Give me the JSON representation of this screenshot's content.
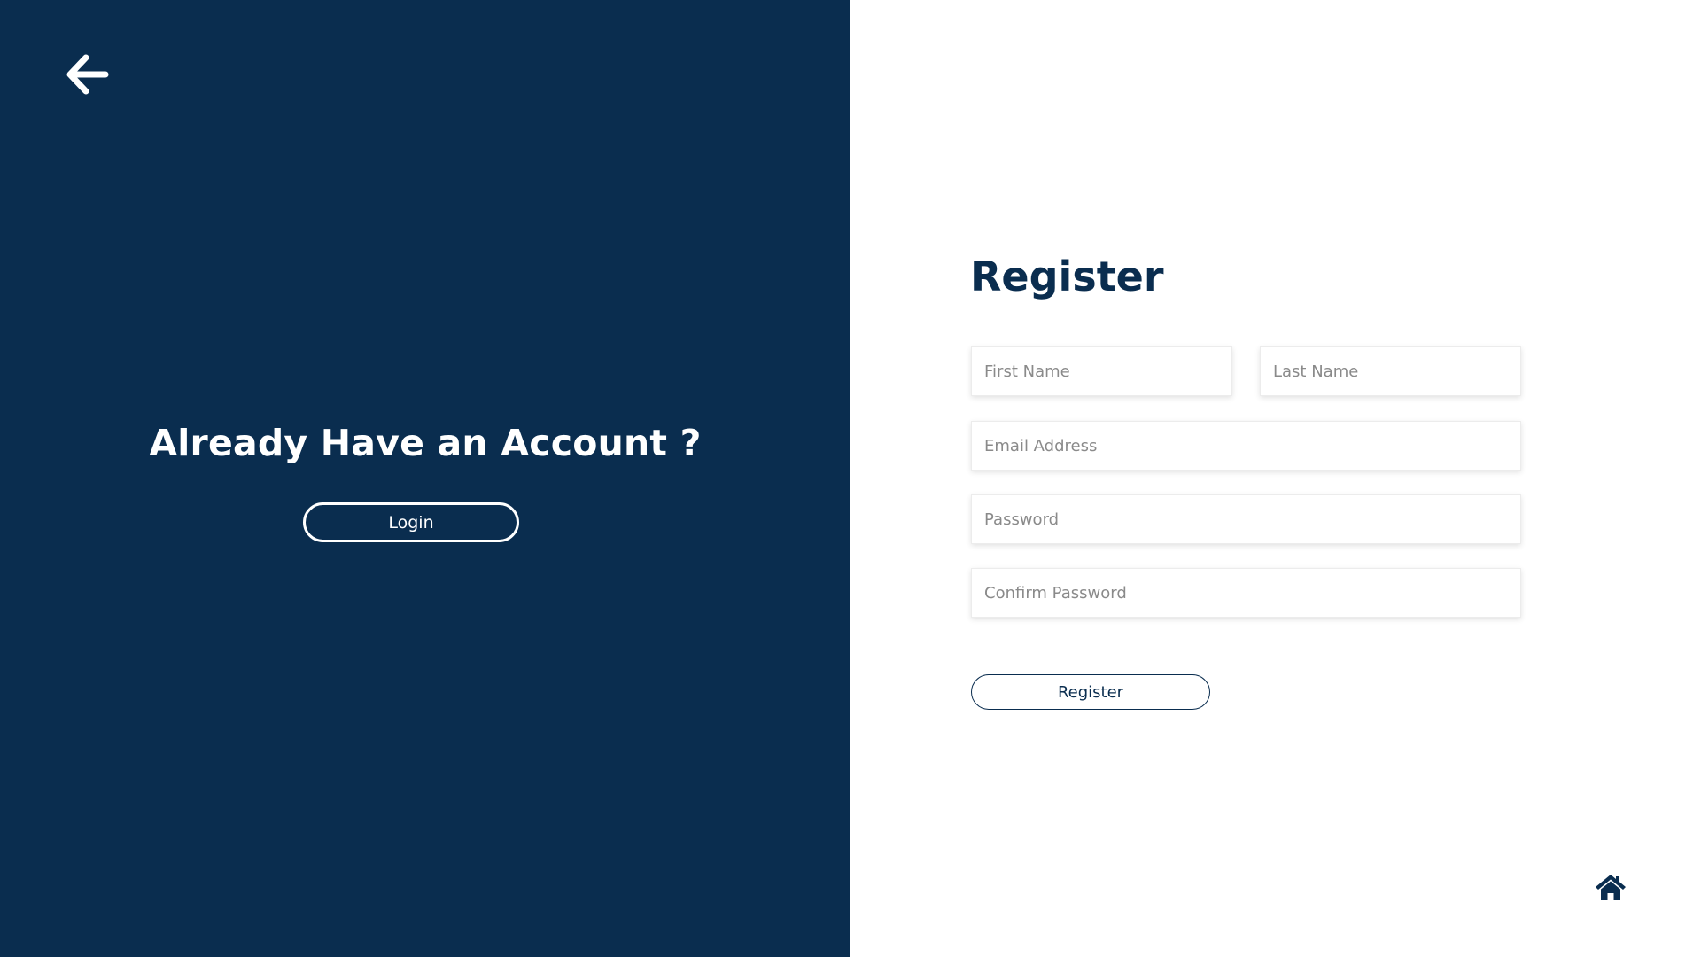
{
  "colors": {
    "panel_bg": "#0a2d4f",
    "accent": "#0a2d4f",
    "text_on_dark": "#ffffff",
    "placeholder": "#8a8a8a"
  },
  "left_panel": {
    "back_icon": "arrow-left-icon",
    "heading": "Already Have an Account ?",
    "login_label": "Login"
  },
  "form": {
    "title": "Register",
    "first_name_placeholder": "First Name",
    "last_name_placeholder": "Last Name",
    "email_placeholder": "Email Address",
    "password_placeholder": "Password",
    "confirm_password_placeholder": "Confirm Password",
    "submit_label": "Register"
  },
  "footer": {
    "home_icon": "home-icon"
  }
}
